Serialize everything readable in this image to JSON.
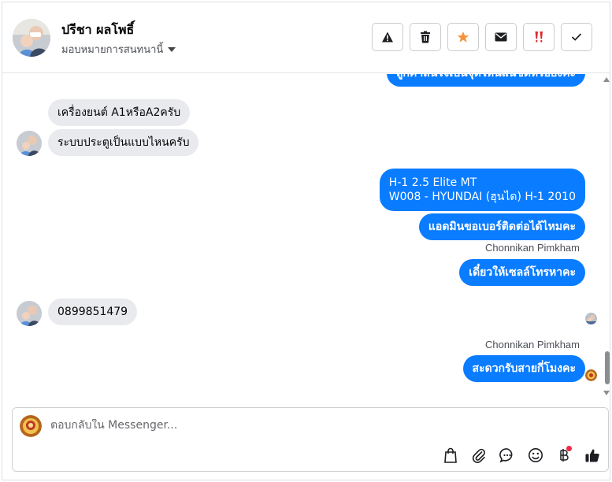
{
  "header": {
    "contact_name": "ปรีชา ผลโพธิ์",
    "assign_label": "มอบหมายการสนทนานี้",
    "actions": [
      {
        "name": "report-button",
        "icon": "warning-icon"
      },
      {
        "name": "delete-button",
        "icon": "trash-icon"
      },
      {
        "name": "star-button",
        "icon": "star-icon",
        "color": "#f7923a"
      },
      {
        "name": "mark-unread-button",
        "icon": "envelope-icon"
      },
      {
        "name": "spam-button",
        "icon": "double-exclamation-icon",
        "color": "#e0282e"
      },
      {
        "name": "mark-done-button",
        "icon": "check-icon"
      }
    ]
  },
  "messages": {
    "partial_top": "ลูกค้าสนใจเป็นจุดไหนแน่ชัดหรือยังคะ",
    "m1": "เครื่องยนต์ A1หรือA2ครับ",
    "m2": "ระบบประตูเป็นแบบไหนครับ",
    "m3_line1": "H-1 2.5 Elite MT",
    "m3_line2": "W008 - HYUNDAI (ฮุนได) H-1 2010",
    "m4": "แอดมินขอเบอร์ติดต่อได้ไหมคะ",
    "sender1": "Chonnikan Pimkham",
    "m5": "เดี๋ยวให้เซลล์โทรหาคะ",
    "m6": "0899851479",
    "sender2": "Chonnikan Pimkham",
    "m7": "สะดวกรับสายกี่โมงคะ"
  },
  "composer": {
    "placeholder": "ตอบกลับใน Messenger...",
    "tools": [
      "shopping-bag-icon",
      "paperclip-icon",
      "saved-reply-icon",
      "emoji-icon",
      "baht-icon",
      "thumbs-up-icon"
    ]
  },
  "colors": {
    "outgoing_bubble": "#0a7cff",
    "incoming_bubble": "#e9eaed",
    "notification_dot": "#f02849"
  }
}
